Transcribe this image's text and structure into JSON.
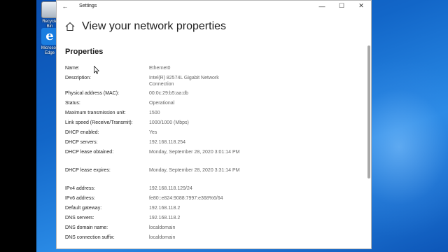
{
  "desktop": {
    "icons": [
      {
        "name": "recycle-bin",
        "label": "Recycle\nBin"
      },
      {
        "name": "edge",
        "label": "Microsoft\nEdge"
      }
    ]
  },
  "window": {
    "title": "Settings",
    "back_glyph": "←",
    "min_glyph": "—",
    "max_glyph": "☐",
    "close_glyph": "✕"
  },
  "page": {
    "title": "View your network properties",
    "section": "Properties"
  },
  "properties": [
    {
      "key": "Name:",
      "value": "Ethernet0"
    },
    {
      "key": "Description:",
      "value": "Intel(R) 82574L Gigabit Network Connection"
    },
    {
      "key": "Physical address (MAC):",
      "value": "00:0c:29:b5:aa:db"
    },
    {
      "key": "Status:",
      "value": "Operational"
    },
    {
      "key": "Maximum transmission unit:",
      "value": "1500"
    },
    {
      "key": "Link speed (Receive/Transmit):",
      "value": "1000/1000 (Mbps)"
    },
    {
      "key": "DHCP enabled:",
      "value": "Yes"
    },
    {
      "key": "DHCP servers:",
      "value": "192.168.118.254"
    },
    {
      "key": "DHCP lease obtained:",
      "value": "Monday, September 28, 2020 3:01:14 PM"
    },
    {
      "key": "DHCP lease expires:",
      "value": "Monday, September 28, 2020 3:31:14 PM"
    },
    {
      "key": "IPv4 address:",
      "value": "192.168.118.129/24"
    },
    {
      "key": "IPv6 address:",
      "value": "fe80::e824:9088:7997:e368%6/64"
    },
    {
      "key": "Default gateway:",
      "value": "192.168.118.2"
    },
    {
      "key": "DNS servers:",
      "value": "192.168.118.2"
    },
    {
      "key": "DNS domain name:",
      "value": "localdomain"
    },
    {
      "key": "DNS connection suffix:",
      "value": "localdomain"
    }
  ],
  "colors": {
    "desktop_blue": "#1266c8",
    "scroll_thumb": "#a8a8a8",
    "value_gray": "#666666"
  }
}
